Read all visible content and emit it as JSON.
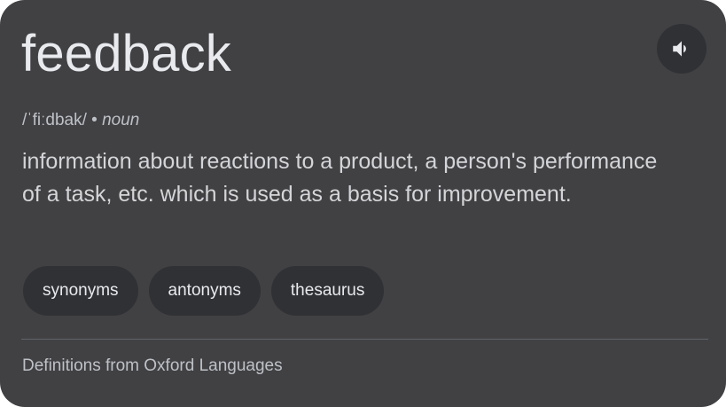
{
  "entry": {
    "word": "feedback",
    "pronunciation": "/ˈfiːdbak/",
    "separator": " • ",
    "part_of_speech": "noun",
    "definition": "information about reactions to a product, a person's performance of a task, etc. which is used as a basis for improvement."
  },
  "icons": {
    "speaker": "speaker-icon"
  },
  "chips": [
    {
      "label": "synonyms"
    },
    {
      "label": "antonyms"
    },
    {
      "label": "thesaurus"
    }
  ],
  "footer": {
    "source": "Definitions from Oxford Languages"
  },
  "colors": {
    "card_background": "#414144",
    "chip_background": "#303134",
    "primary_text": "#e8eaed",
    "secondary_text": "#bdc1c6"
  }
}
